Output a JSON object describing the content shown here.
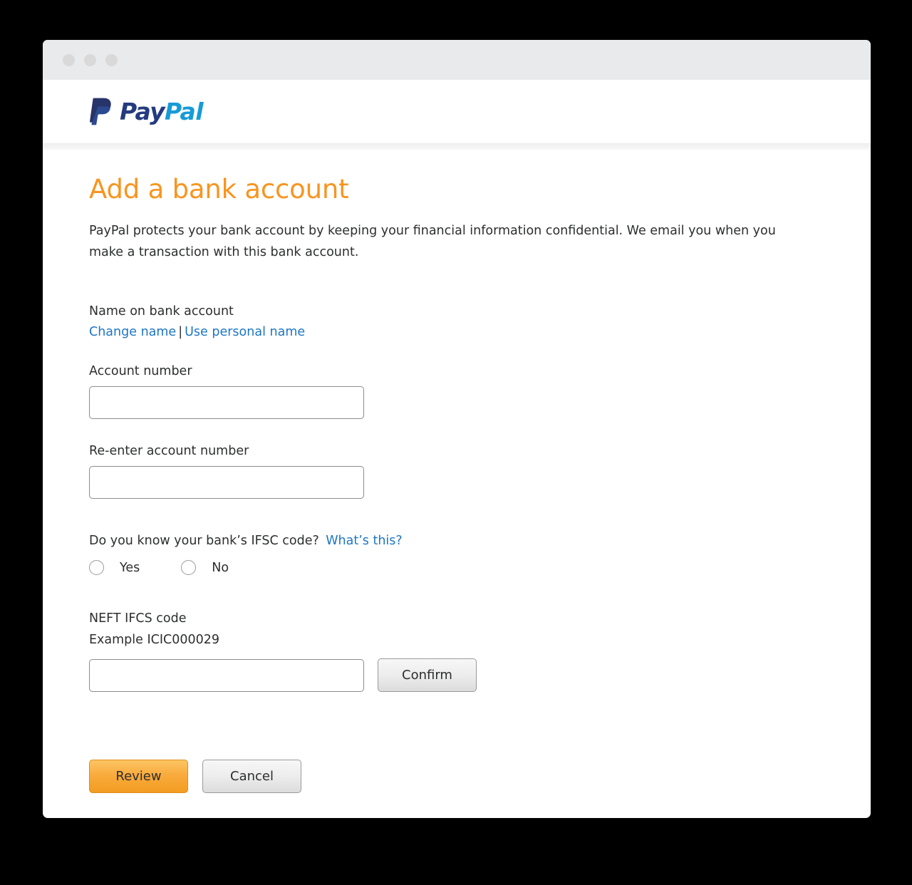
{
  "window": {
    "traffic_lights": [
      "close-dot",
      "minimize-dot",
      "maximize-dot"
    ]
  },
  "header": {
    "brand_pay": "Pay",
    "brand_pal": "Pal",
    "brand_full": "PayPal",
    "logo_icon": "paypal-p-logo",
    "brand_color_dark": "#253b80",
    "brand_color_light": "#179bd7"
  },
  "page": {
    "title": "Add a bank account",
    "title_color": "#f89520",
    "intro": "PayPal protects your bank account by keeping your financial information confidential. We email you when you make a transaction with this bank account."
  },
  "form": {
    "name_section": {
      "label": "Name on bank account",
      "change_name_link": "Change name",
      "separator": "|",
      "use_personal_name_link": "Use personal name"
    },
    "account_number": {
      "label": "Account number",
      "value": "",
      "placeholder": ""
    },
    "reenter_account_number": {
      "label": "Re-enter account number",
      "value": "",
      "placeholder": ""
    },
    "ifsc_question": {
      "text": "Do you know your bank’s IFSC code?",
      "help_link": "What’s this?",
      "options": [
        {
          "label": "Yes",
          "selected": false
        },
        {
          "label": "No",
          "selected": false
        }
      ]
    },
    "neft": {
      "label": "NEFT IFCS code",
      "example": "Example ICIC000029",
      "value": "",
      "placeholder": "",
      "confirm_label": "Confirm"
    },
    "actions": {
      "primary_label": "Review",
      "secondary_label": "Cancel"
    }
  },
  "colors": {
    "link": "#1e76c3",
    "text": "#2c2e2f",
    "accent_orange": "#f89520",
    "titlebar": "#e9eaec"
  }
}
